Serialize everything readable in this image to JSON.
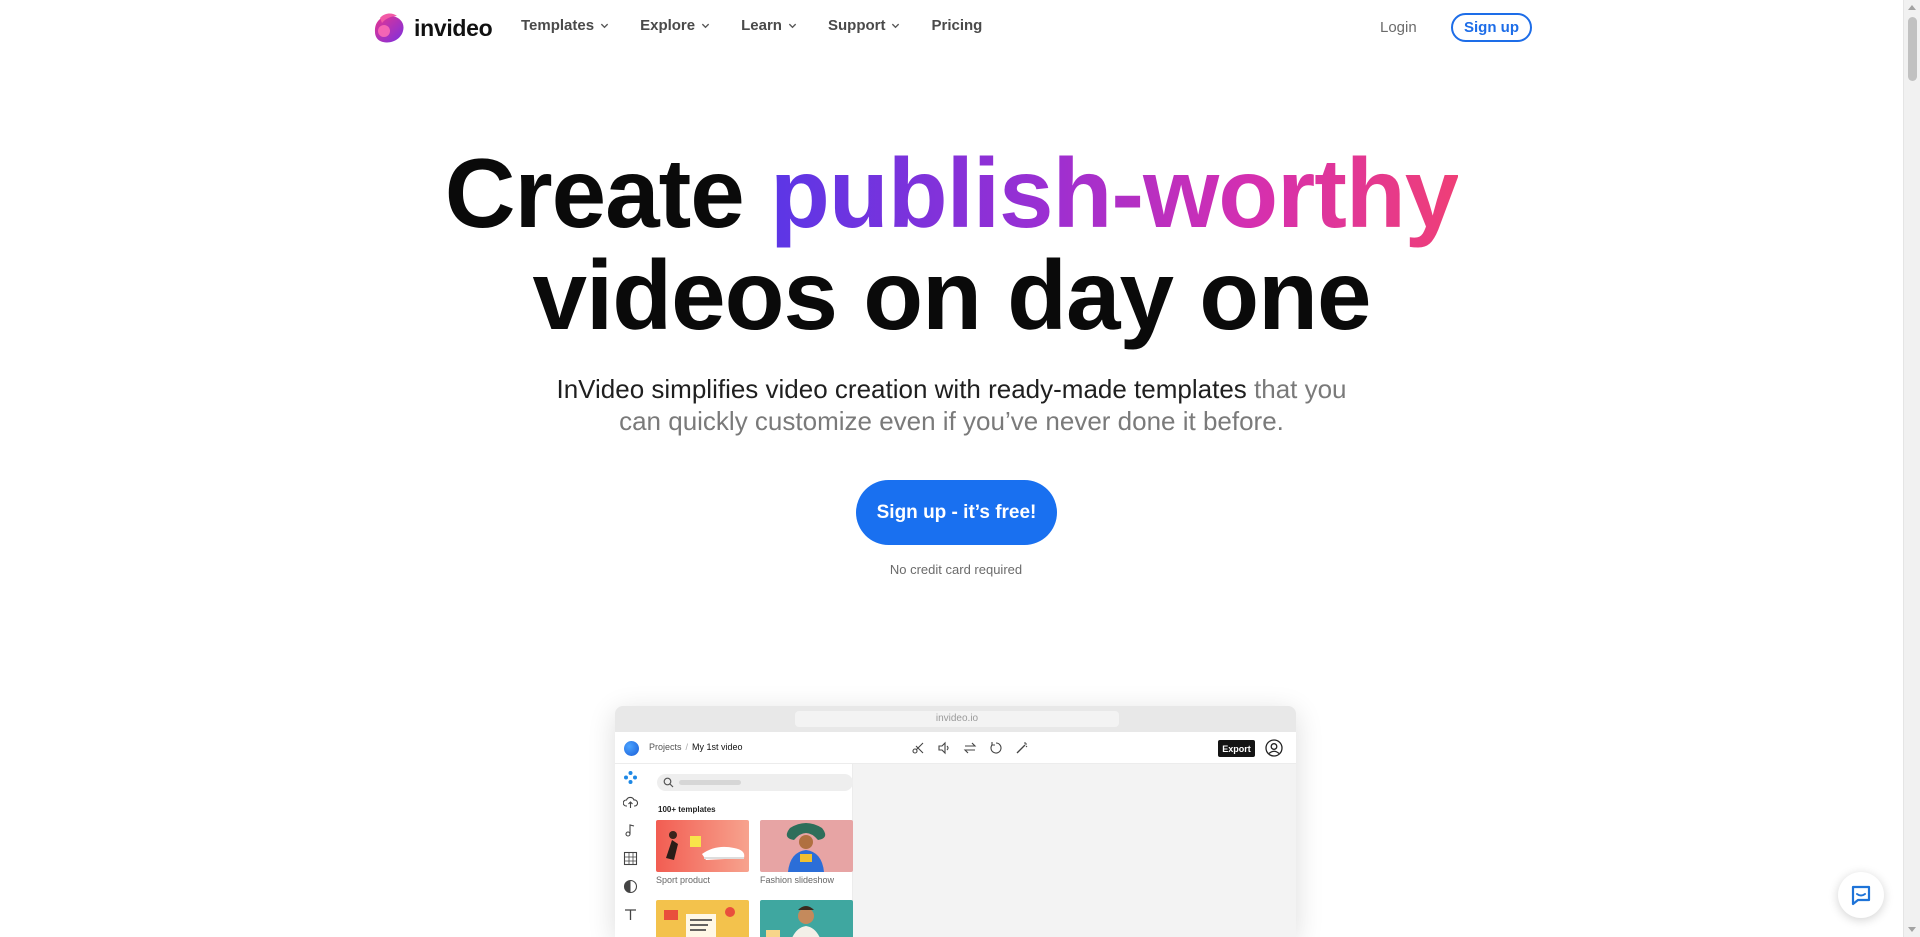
{
  "nav": {
    "logo_text": "invideo",
    "menu": [
      {
        "label": "Templates",
        "has_dropdown": true
      },
      {
        "label": "Explore",
        "has_dropdown": true
      },
      {
        "label": "Learn",
        "has_dropdown": true
      },
      {
        "label": "Support",
        "has_dropdown": true
      },
      {
        "label": "Pricing",
        "has_dropdown": false
      }
    ],
    "login_label": "Login",
    "signup_label": "Sign up"
  },
  "hero": {
    "title_plain_1": "Create ",
    "title_highlight": "publish-worthy",
    "title_line_2": "videos on day one",
    "subtitle_dark": "InVideo simplifies video creation with ready-made templates",
    "subtitle_muted_1": " that you",
    "subtitle_muted_2": "can quickly customize even if you’ve never done it before.",
    "cta_label": "Sign up - it’s free!",
    "cta_note": "No credit card required",
    "gradient_colors": [
      "#5b36e6",
      "#9b2fd2",
      "#d52fb0",
      "#ef3f77"
    ],
    "accent_color": "#1970f0"
  },
  "preview": {
    "url": "invideo.io",
    "breadcrumb_root": "Projects",
    "breadcrumb_sep": "/",
    "breadcrumb_current": "My 1st video",
    "export_label": "Export",
    "templates_count": "100+ templates",
    "templates": [
      {
        "label": "Sport product"
      },
      {
        "label": "Fashion slideshow"
      },
      {
        "label": ""
      },
      {
        "label": ""
      }
    ]
  }
}
